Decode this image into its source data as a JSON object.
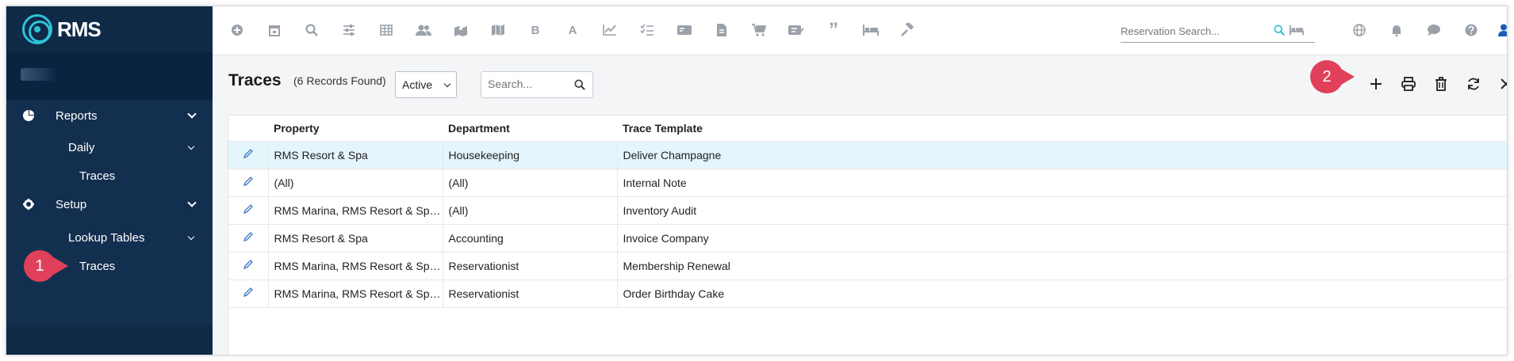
{
  "app": {
    "logo_text": "RMS"
  },
  "sidebar": {
    "items": [
      {
        "label": "Reports",
        "icon": "pie-chart-icon"
      },
      {
        "label": "Daily"
      },
      {
        "label": "Traces"
      },
      {
        "label": "Setup",
        "icon": "gear-icon"
      },
      {
        "label": "Lookup Tables"
      },
      {
        "label": "Traces"
      }
    ],
    "callout_1": "1"
  },
  "topbar": {
    "icons": [
      "plus-circle-icon",
      "calendar-icon",
      "search-icon",
      "sliders-icon",
      "grid-icon",
      "users-icon",
      "map-pin-icon",
      "map-icon",
      "bold-b-icon",
      "font-a-icon",
      "line-chart-icon",
      "checklist-icon",
      "card-icon",
      "document-icon",
      "cart-icon",
      "ticket-icon",
      "quote-icon",
      "bed-icon",
      "gavel-icon"
    ],
    "letters": {
      "bold": "B",
      "font": "A",
      "quote": "”"
    },
    "reservation_search_placeholder": "Reservation Search...",
    "right_icons": [
      "globe-icon",
      "bell-icon",
      "chat-icon",
      "help-icon",
      "user-icon"
    ]
  },
  "page": {
    "title": "Traces",
    "record_count": "(6 Records Found)",
    "status_filter": "Active",
    "search_placeholder": "Search...",
    "callout_2": "2",
    "actions": [
      "add-icon",
      "print-icon",
      "delete-icon",
      "refresh-icon",
      "close-icon"
    ]
  },
  "table": {
    "columns": [
      "Property",
      "Department",
      "Trace Template"
    ],
    "rows": [
      {
        "property": "RMS Resort & Spa",
        "department": "Housekeeping",
        "template": "Deliver Champagne"
      },
      {
        "property": "(All)",
        "department": "(All)",
        "template": "Internal Note"
      },
      {
        "property": "RMS Marina, RMS Resort & Sp…",
        "department": "(All)",
        "template": "Inventory Audit"
      },
      {
        "property": "RMS Resort & Spa",
        "department": "Accounting",
        "template": "Invoice Company"
      },
      {
        "property": "RMS Marina, RMS Resort & Sp…",
        "department": "Reservationist",
        "template": "Membership Renewal"
      },
      {
        "property": "RMS Marina, RMS Resort & Sp…",
        "department": "Reservationist",
        "template": "Order Birthday Cake"
      }
    ]
  },
  "colors": {
    "sidebar": "#0e2a47",
    "accent": "#2fc3d9",
    "callout": "#e0405a",
    "row_highlight": "#e4f5fb"
  }
}
